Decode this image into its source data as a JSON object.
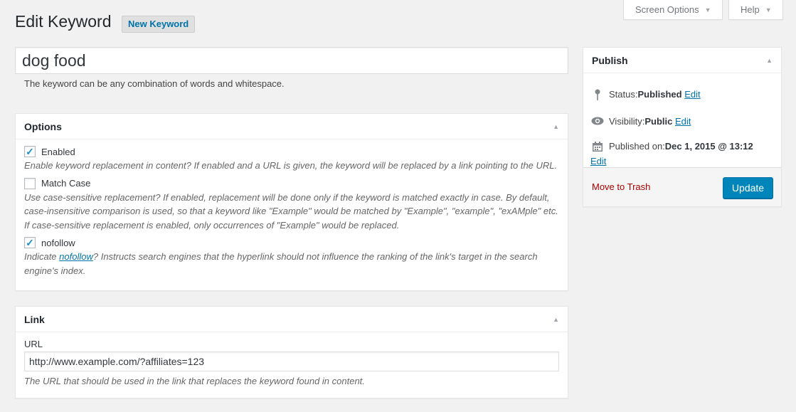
{
  "screen_meta": {
    "screen_options": "Screen Options",
    "help": "Help"
  },
  "heading": {
    "title": "Edit Keyword",
    "add_new": "New Keyword"
  },
  "title_field": {
    "value": "dog food",
    "hint": "The keyword can be any combination of words and whitespace."
  },
  "options": {
    "title": "Options",
    "items": [
      {
        "label": "Enabled",
        "checked": true,
        "desc": "Enable keyword replacement in content? If enabled and a URL is given, the keyword will be replaced by a link pointing to the URL."
      },
      {
        "label": "Match Case",
        "checked": false,
        "desc": "Use case-sensitive replacement? If enabled, replacement will be done only if the keyword is matched exactly in case. By default, case-insensitive comparison is used, so that a keyword like \"Example\" would be matched by \"Example\", \"example\", \"exAMple\" etc. If case-sensitive replacement is enabled, only occurrences of \"Example\" would be replaced."
      },
      {
        "label": "nofollow",
        "checked": true,
        "desc_before": "Indicate ",
        "desc_link": "nofollow",
        "desc_after": "? Instructs search engines that the hyperlink should not influence the ranking of the link's target in the search engine's index."
      }
    ]
  },
  "link": {
    "title": "Link",
    "url_label": "URL",
    "url_value": "http://www.example.com/?affiliates=123",
    "desc": "The URL that should be used in the link that replaces the keyword found in content."
  },
  "publish": {
    "title": "Publish",
    "status_label": "Status: ",
    "status_value": "Published",
    "visibility_label": "Visibility: ",
    "visibility_value": "Public",
    "published_on_label": "Published on: ",
    "published_on_value": "Dec 1, 2015 @ 13:12",
    "edit": "Edit",
    "move_to_trash": "Move to Trash",
    "update": "Update"
  },
  "icons": {
    "pin": "pin-icon",
    "eye": "eye-icon",
    "calendar": "calendar-icon",
    "toggle": "triangle-up-icon",
    "caret": "caret-down-icon"
  },
  "colors": {
    "accent": "#0073aa",
    "button": "#0085ba",
    "trash": "#aa0000",
    "background": "#f1f1f1"
  }
}
